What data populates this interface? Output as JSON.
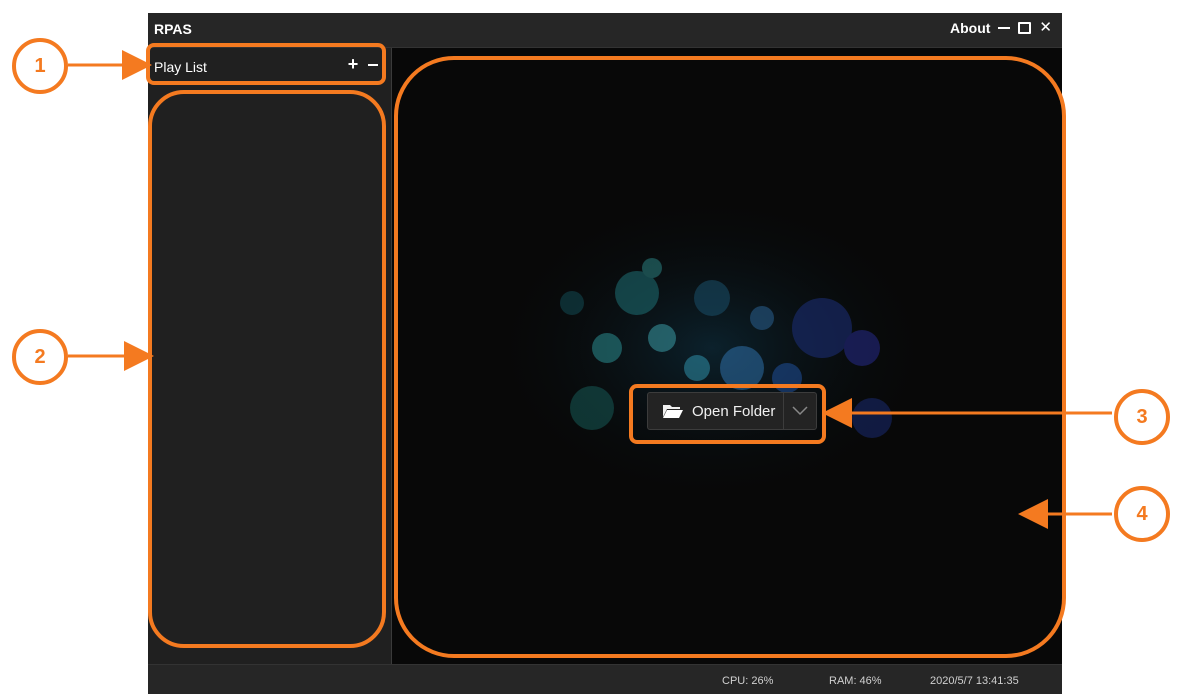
{
  "app": {
    "title": "RPAS"
  },
  "titlebar": {
    "about_label": "About",
    "minimize_icon": "minimize-icon",
    "maximize_icon": "maximize-icon",
    "close_label": "✕"
  },
  "sidebar": {
    "header_label": "Play List",
    "add_label": "+",
    "remove_icon": "minus-icon",
    "items": []
  },
  "viewer": {
    "open_folder_label": "Open Folder",
    "open_folder_icon": "folder-open-icon",
    "dropdown_icon": "chevron-down-icon"
  },
  "statusbar": {
    "cpu": "CPU: 26%",
    "ram": "RAM: 46%",
    "datetime": "2020/5/7 13:41:35"
  },
  "annotations": {
    "callouts": [
      "1",
      "2",
      "3",
      "4"
    ],
    "color": "#f47a20"
  },
  "colors": {
    "window_bg": "#1c1c1c",
    "viewer_bg": "#080808",
    "accent": "#f47a20"
  }
}
